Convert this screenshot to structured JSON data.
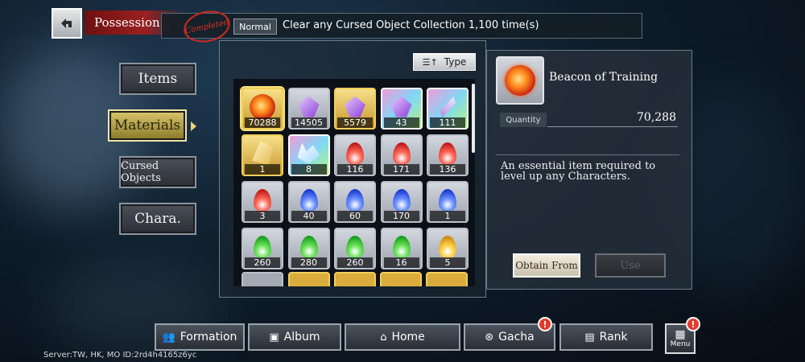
{
  "header": {
    "back_icon": "back-arrow-icon",
    "title": "Possession",
    "completed_stamp": "Completed",
    "mission_badge": "Normal",
    "mission_text": "Clear any Cursed Object Collection 1,100 time(s)"
  },
  "sidebar": {
    "items": [
      {
        "label": "Items"
      },
      {
        "label": "Materials"
      },
      {
        "label": "Cursed Objects"
      },
      {
        "label": "Chara."
      }
    ]
  },
  "grid": {
    "sort_label": "Type",
    "slots": [
      {
        "count": "70288",
        "frame": "gold",
        "icon": "fire-orb-icon"
      },
      {
        "count": "14505",
        "frame": "normal",
        "icon": "purple-crystal-icon"
      },
      {
        "count": "5579",
        "frame": "gold",
        "icon": "purple-crystal-icon"
      },
      {
        "count": "43",
        "frame": "rainbow",
        "icon": "purple-crystal-icon"
      },
      {
        "count": "111",
        "frame": "rainbow",
        "icon": "crystal-shard-icon"
      },
      {
        "count": "1",
        "frame": "gold",
        "icon": "gold-crystal-icon"
      },
      {
        "count": "8",
        "frame": "rainbow",
        "icon": "ice-shard-icon"
      },
      {
        "count": "116",
        "frame": "normal",
        "icon": "red-flame-icon"
      },
      {
        "count": "171",
        "frame": "normal",
        "icon": "red-flame-icon"
      },
      {
        "count": "136",
        "frame": "normal",
        "icon": "red-flame-icon"
      },
      {
        "count": "3",
        "frame": "normal",
        "icon": "red-flame-icon"
      },
      {
        "count": "40",
        "frame": "normal",
        "icon": "blue-flame-icon"
      },
      {
        "count": "60",
        "frame": "normal",
        "icon": "blue-flame-icon"
      },
      {
        "count": "170",
        "frame": "normal",
        "icon": "blue-flame-icon"
      },
      {
        "count": "1",
        "frame": "normal",
        "icon": "blue-flame-icon"
      },
      {
        "count": "260",
        "frame": "normal",
        "icon": "green-flame-icon"
      },
      {
        "count": "280",
        "frame": "normal",
        "icon": "green-flame-icon"
      },
      {
        "count": "260",
        "frame": "normal",
        "icon": "green-flame-icon"
      },
      {
        "count": "16",
        "frame": "normal",
        "icon": "green-flame-icon"
      },
      {
        "count": "5",
        "frame": "normal",
        "icon": "gold-flame-icon"
      }
    ]
  },
  "detail": {
    "item_name": "Beacon of Training",
    "quantity_label": "Quantity",
    "quantity_value": "70,288",
    "description": "An essential item required to level up any Characters.",
    "obtain_label": "Obtain From",
    "use_label": "Use"
  },
  "bottom_nav": [
    {
      "label": "Formation",
      "icon": "formation-icon"
    },
    {
      "label": "Album",
      "icon": "album-icon"
    },
    {
      "label": "Home",
      "icon": "home-icon"
    },
    {
      "label": "Gacha",
      "icon": "gacha-icon"
    },
    {
      "label": "Rank",
      "icon": "rank-icon"
    }
  ],
  "menu_label": "Menu",
  "alert_mark": "!",
  "server_info": "Server:TW, HK, MO ID:2rd4h4165z6yc",
  "colors": {
    "accent_gold": "#d9c66a",
    "header_red": "#8b1a1a",
    "alert_red": "#e23b2e"
  }
}
